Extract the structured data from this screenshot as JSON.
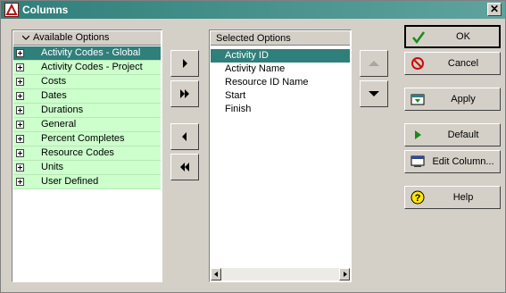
{
  "window": {
    "title": "Columns",
    "close_glyph": "✕"
  },
  "available": {
    "header": "Available Options",
    "items": [
      {
        "label": "Activity Codes - Global",
        "selected": true
      },
      {
        "label": "Activity Codes - Project",
        "selected": false
      },
      {
        "label": "Costs",
        "selected": false
      },
      {
        "label": "Dates",
        "selected": false
      },
      {
        "label": "Durations",
        "selected": false
      },
      {
        "label": "General",
        "selected": false
      },
      {
        "label": "Percent Completes",
        "selected": false
      },
      {
        "label": "Resource Codes",
        "selected": false
      },
      {
        "label": "Units",
        "selected": false
      },
      {
        "label": "User Defined",
        "selected": false
      }
    ]
  },
  "selected_options": {
    "header": "Selected Options",
    "items": [
      {
        "label": "Activity ID",
        "selected": true
      },
      {
        "label": "Activity Name",
        "selected": false
      },
      {
        "label": "Resource ID Name",
        "selected": false
      },
      {
        "label": "Start",
        "selected": false
      },
      {
        "label": "Finish",
        "selected": false
      }
    ]
  },
  "move_buttons": {
    "add_icon": "right-arrow-icon",
    "add_all_icon": "double-right-arrow-icon",
    "remove_icon": "left-arrow-icon",
    "remove_all_icon": "double-left-arrow-icon",
    "up_icon": "up-arrow-icon",
    "down_icon": "down-arrow-icon",
    "up_enabled": false,
    "down_enabled": true
  },
  "actions": {
    "ok": "OK",
    "cancel": "Cancel",
    "apply": "Apply",
    "default": "Default",
    "edit_column": "Edit Column...",
    "help": "Help"
  },
  "colors": {
    "selection": "#2f7f7a",
    "option_bg": "#ccffcc",
    "dialog_bg": "#d4d0c8"
  }
}
